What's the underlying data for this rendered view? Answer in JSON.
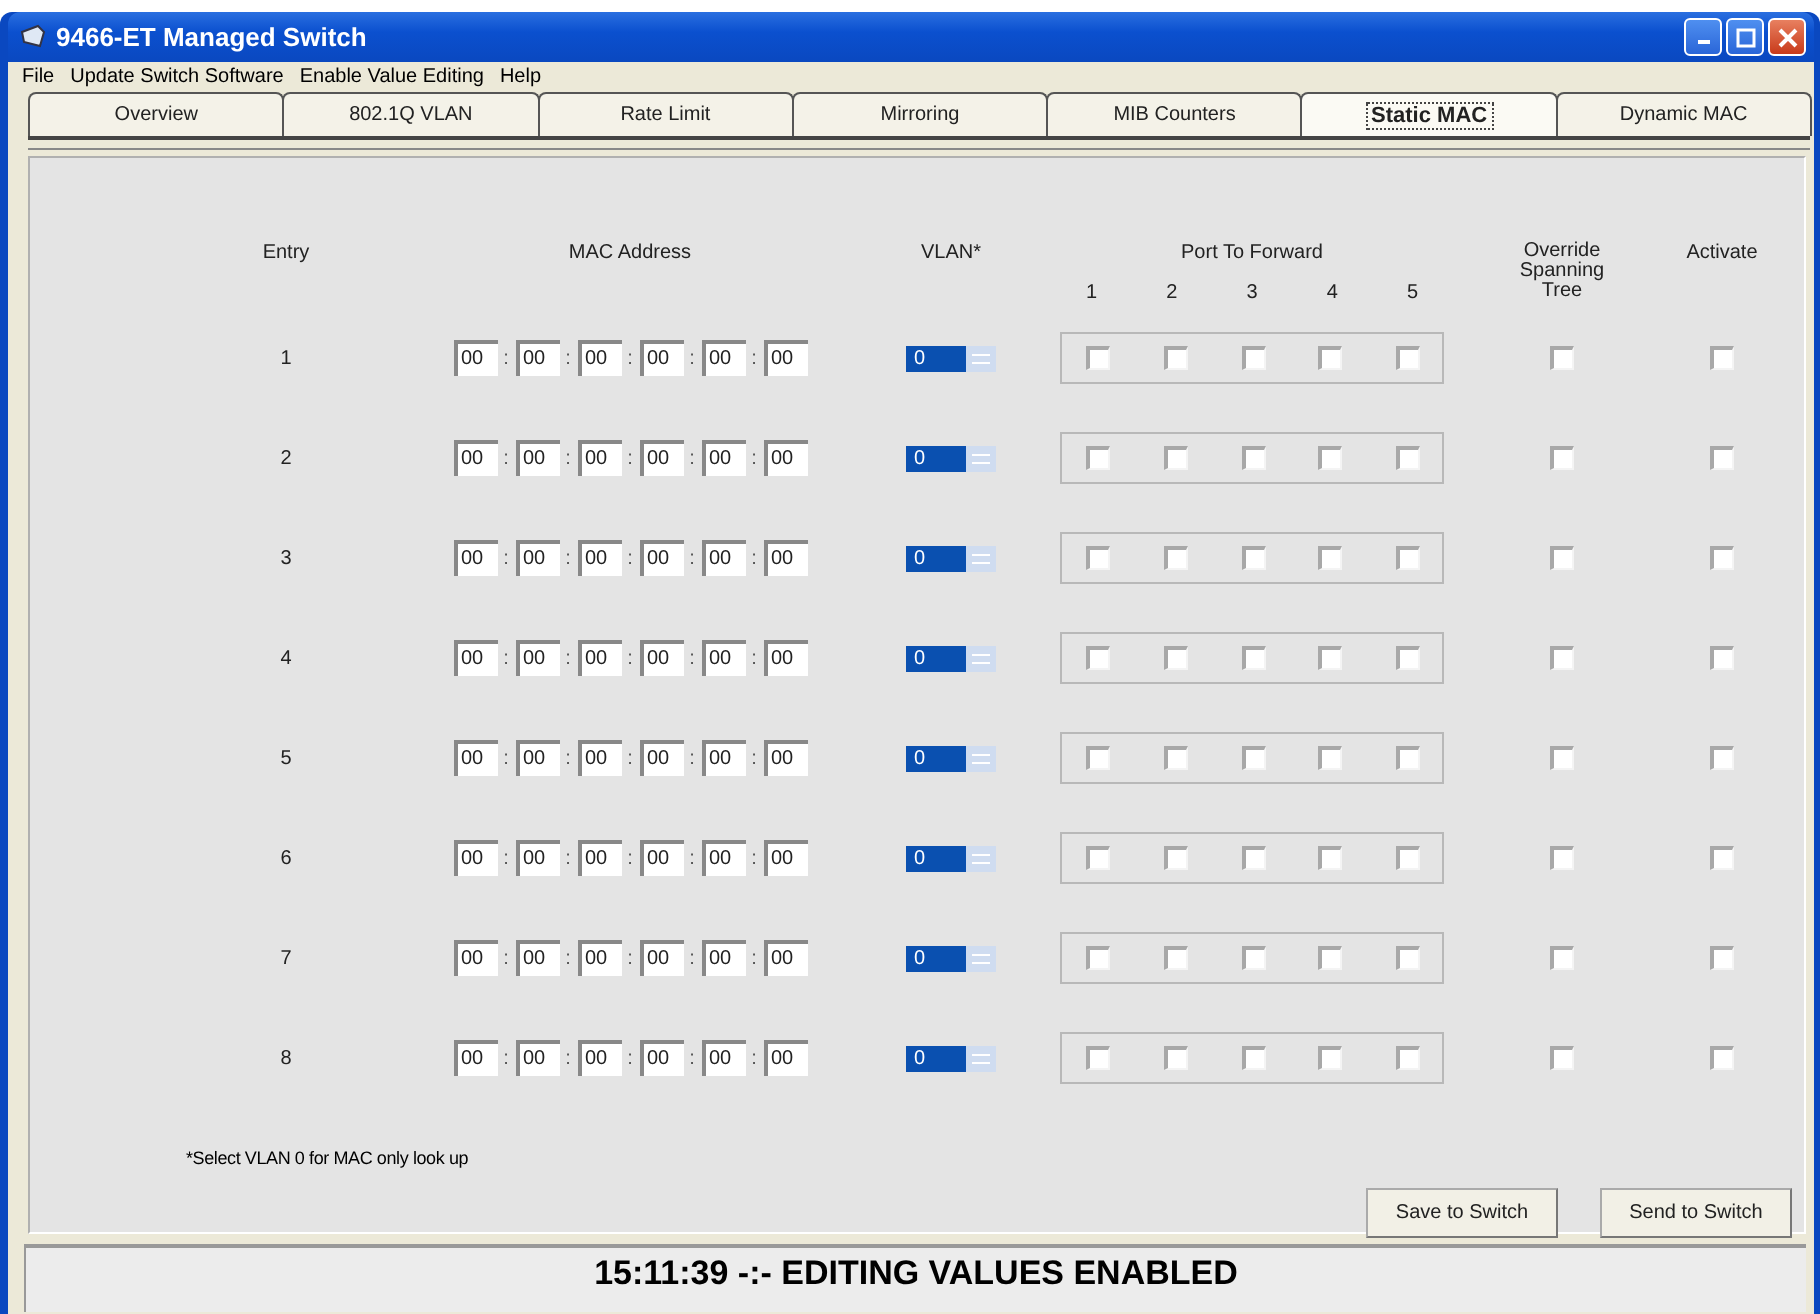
{
  "window": {
    "title": "9466-ET Managed Switch"
  },
  "menu": [
    "File",
    "Update Switch Software",
    "Enable Value Editing",
    "Help"
  ],
  "tabs": [
    {
      "label": "Overview",
      "selected": false
    },
    {
      "label": "802.1Q VLAN",
      "selected": false
    },
    {
      "label": "Rate Limit",
      "selected": false
    },
    {
      "label": "Mirroring",
      "selected": false
    },
    {
      "label": "MIB Counters",
      "selected": false
    },
    {
      "label": "Static MAC",
      "selected": true
    },
    {
      "label": "Dynamic MAC",
      "selected": false
    }
  ],
  "table": {
    "columns": {
      "entry": "Entry",
      "mac": "MAC Address",
      "vlan": "VLAN*",
      "ports": "Port To Forward",
      "port_numbers": [
        "1",
        "2",
        "3",
        "4",
        "5"
      ],
      "override": "Override Spanning Tree",
      "activate": "Activate"
    },
    "rows": [
      {
        "entry": "1",
        "mac": [
          "00",
          "00",
          "00",
          "00",
          "00",
          "00"
        ],
        "separators": [
          ":",
          ":",
          ":",
          ":",
          ":"
        ],
        "vlan": "0",
        "vlan_selected": true,
        "ports": [
          false,
          false,
          false,
          false,
          false
        ],
        "override": false,
        "activate": false
      },
      {
        "entry": "2",
        "mac": [
          "00",
          "00",
          "00",
          "00",
          "00",
          "00"
        ],
        "separators": [
          ":",
          ":",
          ":",
          ":",
          ":"
        ],
        "vlan": "0",
        "vlan_selected": true,
        "ports": [
          false,
          false,
          false,
          false,
          false
        ],
        "override": false,
        "activate": false
      },
      {
        "entry": "3",
        "mac": [
          "00",
          "00",
          "00",
          "00",
          "00",
          "00"
        ],
        "separators": [
          ":",
          ":",
          ":",
          ":",
          ":"
        ],
        "vlan": "0",
        "vlan_selected": true,
        "ports": [
          false,
          false,
          false,
          false,
          false
        ],
        "override": false,
        "activate": false
      },
      {
        "entry": "4",
        "mac": [
          "00",
          "00",
          "00",
          "00",
          "00",
          "00"
        ],
        "separators": [
          ":",
          ":",
          ":",
          ":",
          ":"
        ],
        "vlan": "0",
        "vlan_selected": true,
        "ports": [
          false,
          false,
          false,
          false,
          false
        ],
        "override": false,
        "activate": false
      },
      {
        "entry": "5",
        "mac": [
          "00",
          "00",
          "00",
          "00",
          "00",
          "00"
        ],
        "separators": [
          ":",
          ":",
          ":",
          ":",
          ":"
        ],
        "vlan": "0",
        "vlan_selected": true,
        "ports": [
          false,
          false,
          false,
          false,
          false
        ],
        "override": false,
        "activate": false
      },
      {
        "entry": "6",
        "mac": [
          "00",
          "00",
          "00",
          "00",
          "00",
          "00"
        ],
        "separators": [
          ":",
          ":",
          ":",
          ":",
          ":"
        ],
        "vlan": "0",
        "vlan_selected": true,
        "ports": [
          false,
          false,
          false,
          false,
          false
        ],
        "override": false,
        "activate": false
      },
      {
        "entry": "7",
        "mac": [
          "00",
          "00",
          "00",
          "00",
          "00",
          "00"
        ],
        "separators": [
          ":",
          ":",
          ":",
          ":",
          ":"
        ],
        "vlan": "0",
        "vlan_selected": true,
        "ports": [
          false,
          false,
          false,
          false,
          false
        ],
        "override": false,
        "activate": false
      },
      {
        "entry": "8",
        "mac": [
          "00",
          "00",
          "00",
          "00",
          "00",
          "00"
        ],
        "separators": [
          ":",
          ":",
          ":",
          ":",
          ":"
        ],
        "vlan": "0",
        "vlan_selected": true,
        "ports": [
          false,
          false,
          false,
          false,
          false
        ],
        "override": false,
        "activate": false
      }
    ]
  },
  "footnote": "*Select VLAN 0 for MAC only look up",
  "buttons": [
    "Save to Switch",
    "Send to Switch"
  ],
  "status_bar": "15:11:39 -:- EDITING VALUES ENABLED"
}
